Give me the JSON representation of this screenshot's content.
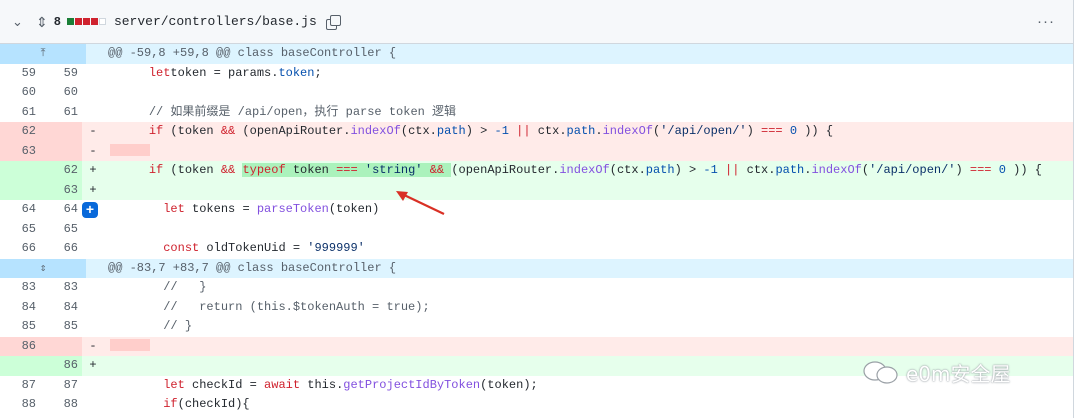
{
  "file": {
    "change_count": "8",
    "diffstat": [
      "add",
      "del",
      "del",
      "del",
      "neu"
    ],
    "path": "server/controllers/base.js",
    "more_label": "···"
  },
  "hunks": [
    {
      "header": "@@ -59,8 +59,8 @@ class baseController {",
      "lines": [
        {
          "type": "ctx",
          "old": "59",
          "new": "59",
          "sign": "",
          "indent": "    ",
          "tokens": [
            [
              "kw",
              "let"
            ],
            [
              "",
              "token = params."
            ],
            [
              "prop",
              "token"
            ],
            [
              "",
              ";"
            ]
          ]
        },
        {
          "type": "ctx",
          "old": "60",
          "new": "60",
          "sign": "",
          "indent": "",
          "tokens": []
        },
        {
          "type": "ctx",
          "old": "61",
          "new": "61",
          "sign": "",
          "indent": "    ",
          "tokens": [
            [
              "cm",
              "// 如果前缀是 /api/open，执行 parse token 逻辑"
            ]
          ]
        },
        {
          "type": "del",
          "old": "62",
          "new": "",
          "sign": "-",
          "indent": "    ",
          "tokens": [
            [
              "kw",
              "if"
            ],
            [
              "",
              " (token "
            ],
            [
              "kw",
              "&&"
            ],
            [
              "",
              " (openApiRouter."
            ],
            [
              "fn",
              "indexOf"
            ],
            [
              "",
              "(ctx."
            ],
            [
              "prop",
              "path"
            ],
            [
              "",
              ") > "
            ],
            [
              "num",
              "-1"
            ],
            [
              "",
              " "
            ],
            [
              "kw",
              "||"
            ],
            [
              "",
              " ctx."
            ],
            [
              "prop",
              "path"
            ],
            [
              "",
              "."
            ],
            [
              "fn",
              "indexOf"
            ],
            [
              "",
              "("
            ],
            [
              "str",
              "'/api/open/'"
            ],
            [
              "",
              ") "
            ],
            [
              "kw",
              "==="
            ],
            [
              "",
              " "
            ],
            [
              "num",
              "0"
            ],
            [
              "",
              " )) {"
            ]
          ]
        },
        {
          "type": "del",
          "old": "63",
          "new": "",
          "sign": "-",
          "indent": "",
          "tokens": [],
          "placeholder": true
        },
        {
          "type": "add",
          "old": "",
          "new": "62",
          "sign": "+",
          "indent": "    ",
          "tokens": [
            [
              "kw",
              "if"
            ],
            [
              "",
              " (token "
            ],
            [
              "kw",
              "&&"
            ],
            [
              "",
              " "
            ],
            [
              "hl kw",
              "typeof"
            ],
            [
              "hl",
              " token "
            ],
            [
              "hl kw",
              "==="
            ],
            [
              "hl",
              " "
            ],
            [
              "hl str",
              "'string'"
            ],
            [
              "hl",
              " "
            ],
            [
              "hl kw",
              "&&"
            ],
            [
              "hl",
              " "
            ],
            [
              "",
              "(openApiRouter."
            ],
            [
              "fn",
              "indexOf"
            ],
            [
              "",
              "(ctx."
            ],
            [
              "prop",
              "path"
            ],
            [
              "",
              ") > "
            ],
            [
              "num",
              "-1"
            ],
            [
              "",
              " "
            ],
            [
              "kw",
              "||"
            ],
            [
              "",
              " ctx."
            ],
            [
              "prop",
              "path"
            ],
            [
              "",
              "."
            ],
            [
              "fn",
              "indexOf"
            ],
            [
              "",
              "("
            ],
            [
              "str",
              "'/api/open/'"
            ],
            [
              "",
              ") "
            ],
            [
              "kw",
              "==="
            ],
            [
              "",
              " "
            ],
            [
              "num",
              "0"
            ],
            [
              "",
              " )) {"
            ]
          ]
        },
        {
          "type": "add",
          "old": "",
          "new": "63",
          "sign": "+",
          "indent": "",
          "tokens": []
        },
        {
          "type": "ctx",
          "old": "64",
          "new": "64",
          "sign": "",
          "indent": "      ",
          "tokens": [
            [
              "kw",
              "let"
            ],
            [
              "",
              " tokens = "
            ],
            [
              "fn",
              "parseToken"
            ],
            [
              "",
              "(token)"
            ]
          ],
          "plus": true
        },
        {
          "type": "ctx",
          "old": "65",
          "new": "65",
          "sign": "",
          "indent": "",
          "tokens": []
        },
        {
          "type": "ctx",
          "old": "66",
          "new": "66",
          "sign": "",
          "indent": "      ",
          "tokens": [
            [
              "kw",
              "const"
            ],
            [
              "",
              " oldTokenUid = "
            ],
            [
              "str",
              "'999999'"
            ]
          ]
        }
      ]
    },
    {
      "header": "@@ -83,7 +83,7 @@ class baseController {",
      "lines": [
        {
          "type": "ctx",
          "old": "83",
          "new": "83",
          "sign": "",
          "indent": "      ",
          "tokens": [
            [
              "cm",
              "//   }"
            ]
          ]
        },
        {
          "type": "ctx",
          "old": "84",
          "new": "84",
          "sign": "",
          "indent": "      ",
          "tokens": [
            [
              "cm",
              "//   return (this.$tokenAuth = true);"
            ]
          ]
        },
        {
          "type": "ctx",
          "old": "85",
          "new": "85",
          "sign": "",
          "indent": "      ",
          "tokens": [
            [
              "cm",
              "// }"
            ]
          ]
        },
        {
          "type": "del",
          "old": "86",
          "new": "",
          "sign": "-",
          "indent": "",
          "tokens": [],
          "placeholder": true
        },
        {
          "type": "add",
          "old": "",
          "new": "86",
          "sign": "+",
          "indent": "",
          "tokens": []
        },
        {
          "type": "ctx",
          "old": "87",
          "new": "87",
          "sign": "",
          "indent": "      ",
          "tokens": [
            [
              "kw",
              "let"
            ],
            [
              "",
              " checkId = "
            ],
            [
              "kw",
              "await"
            ],
            [
              "",
              " this."
            ],
            [
              "fn",
              "getProjectIdByToken"
            ],
            [
              "",
              "(token);"
            ]
          ]
        },
        {
          "type": "ctx",
          "old": "88",
          "new": "88",
          "sign": "",
          "indent": "      ",
          "tokens": [
            [
              "kw",
              "if"
            ],
            [
              "",
              "(checkId){"
            ]
          ]
        }
      ]
    }
  ],
  "watermark": "e0m安全屋",
  "colors": {
    "add_bg": "#e6ffec",
    "del_bg": "#ffebe9",
    "hunk_bg": "#ddf4ff",
    "annotation_arrow": "#d93025"
  },
  "icons": {
    "collapse": "chevron-down-icon",
    "expand_all": "unfold-icon",
    "copy": "copy-icon",
    "expand_up": "expand-up-icon",
    "expand_both": "expand-both-icon",
    "add_comment": "plus-icon"
  }
}
